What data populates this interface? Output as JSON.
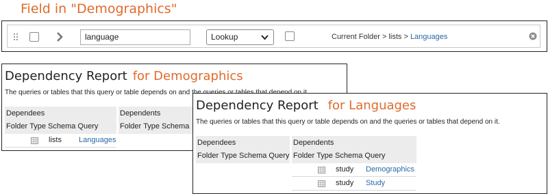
{
  "caption": "Field in \"Demographics\"",
  "field_row": {
    "name_value": "language",
    "data_type": "Lookup",
    "lookup_path_prefix": "Current Folder > lists > ",
    "lookup_target": "Languages"
  },
  "reports": [
    {
      "title": "Dependency Report",
      "subtitle": "for Demographics",
      "description": "The queries or tables that this query or table depends on and the queries or tables that depend on it.",
      "dependees_label": "Dependees",
      "dependents_label": "Dependents",
      "columns": [
        "Folder",
        "Type",
        "Schema",
        "Query"
      ],
      "dependees": [
        {
          "schema": "lists",
          "query": "Languages"
        }
      ],
      "dependents": []
    },
    {
      "title": "Dependency Report",
      "subtitle": "for Languages",
      "description": "The queries or tables that this query or table depends on and the queries or tables that depend on it.",
      "dependees_label": "Dependees",
      "dependents_label": "Dependents",
      "columns": [
        "Folder",
        "Type",
        "Schema",
        "Query"
      ],
      "dependees": [],
      "dependents": [
        {
          "schema": "study",
          "query": "Demographics"
        },
        {
          "schema": "study",
          "query": "Study"
        }
      ]
    }
  ],
  "colors": {
    "accent_orange": "#e06a2c",
    "link_blue": "#2a66a6",
    "header_gray": "#ececec"
  },
  "icons": {
    "drag": "drag-handle-icon",
    "expand": "chevron-right-icon",
    "select": "chevron-down-icon",
    "remove": "remove-circle-icon",
    "table": "table-grid-icon"
  }
}
